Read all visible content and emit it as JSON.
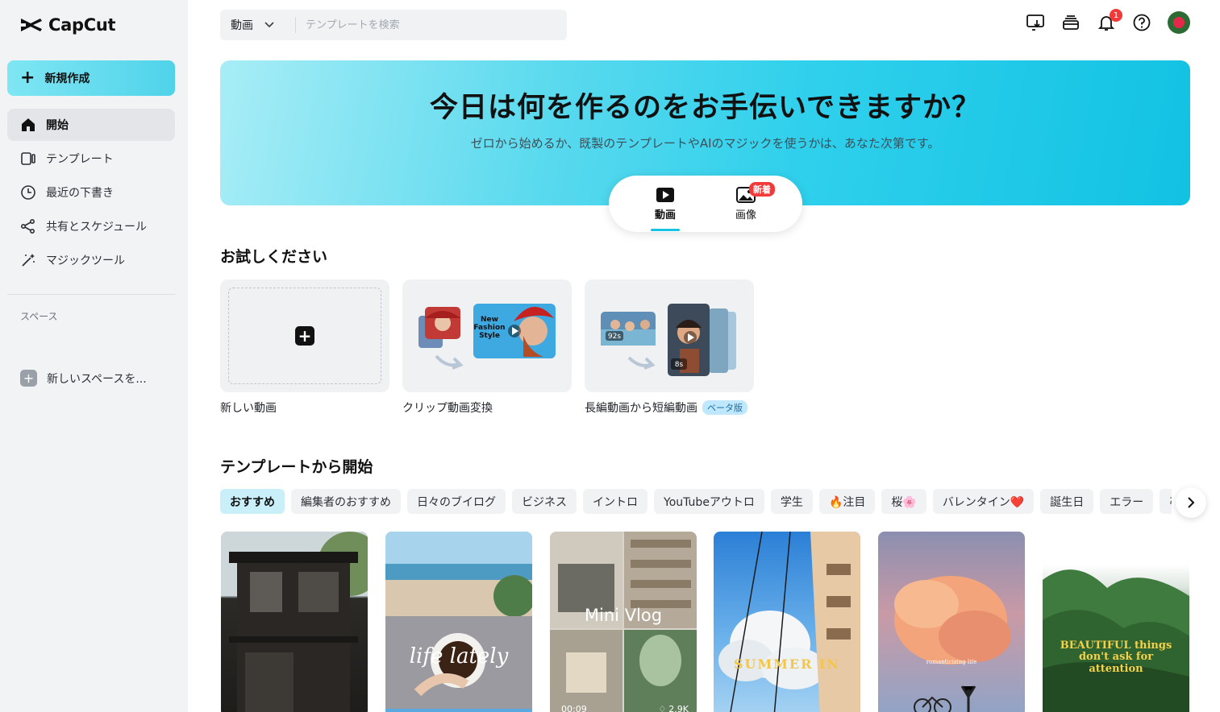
{
  "app": {
    "name": "CapCut"
  },
  "sidebar": {
    "new_label": "新規作成",
    "items": [
      {
        "label": "開始"
      },
      {
        "label": "テンプレート"
      },
      {
        "label": "最近の下書き"
      },
      {
        "label": "共有とスケジュール"
      },
      {
        "label": "マジックツール"
      }
    ],
    "space_section": "スペース",
    "new_space": "新しいスペースを..."
  },
  "topbar": {
    "search_type": "動画",
    "search_placeholder": "テンプレートを検索",
    "notification_count": "1"
  },
  "hero": {
    "title": "今日は何を作るのをお手伝いできますか？",
    "subtitle": "ゼロから始めるか、既製のテンプレートやAIのマジックを使うかは、あなた次第です。",
    "modes": [
      {
        "label": "動画"
      },
      {
        "label": "画像"
      }
    ],
    "new_tag": "新着"
  },
  "try": {
    "title": "お試しください",
    "cards": [
      {
        "label": "新しい動画"
      },
      {
        "label": "クリップ動画変換",
        "thumb_text": "New Fashion Style"
      },
      {
        "label": "長編動画から短編動画",
        "badge": "ベータ版",
        "thumb_left": "92s",
        "thumb_right": "8s"
      }
    ]
  },
  "templates": {
    "title": "テンプレートから開始",
    "chips": [
      "おすすめ",
      "編集者のおすすめ",
      "日々のブイログ",
      "ビジネス",
      "イントロ",
      "YouTubeアウトロ",
      "学生",
      "🔥注目",
      "桜🌸",
      "バレンタイン❤️",
      "誕生日",
      "エラー",
      "卒"
    ],
    "cards": [
      {
        "text": ""
      },
      {
        "text": "life lately"
      },
      {
        "text": "Mini Vlog",
        "duration": "00:09",
        "likes": "2.9K"
      },
      {
        "text": "SUMMER IN"
      },
      {
        "text": "romanticizing life"
      },
      {
        "text": "BEAUTIFUL things don't ask for attention"
      }
    ]
  },
  "colors": {
    "accent": "#17c3e3",
    "badge": "#f23a3a",
    "sidebar_bg": "#f2f3f5"
  }
}
